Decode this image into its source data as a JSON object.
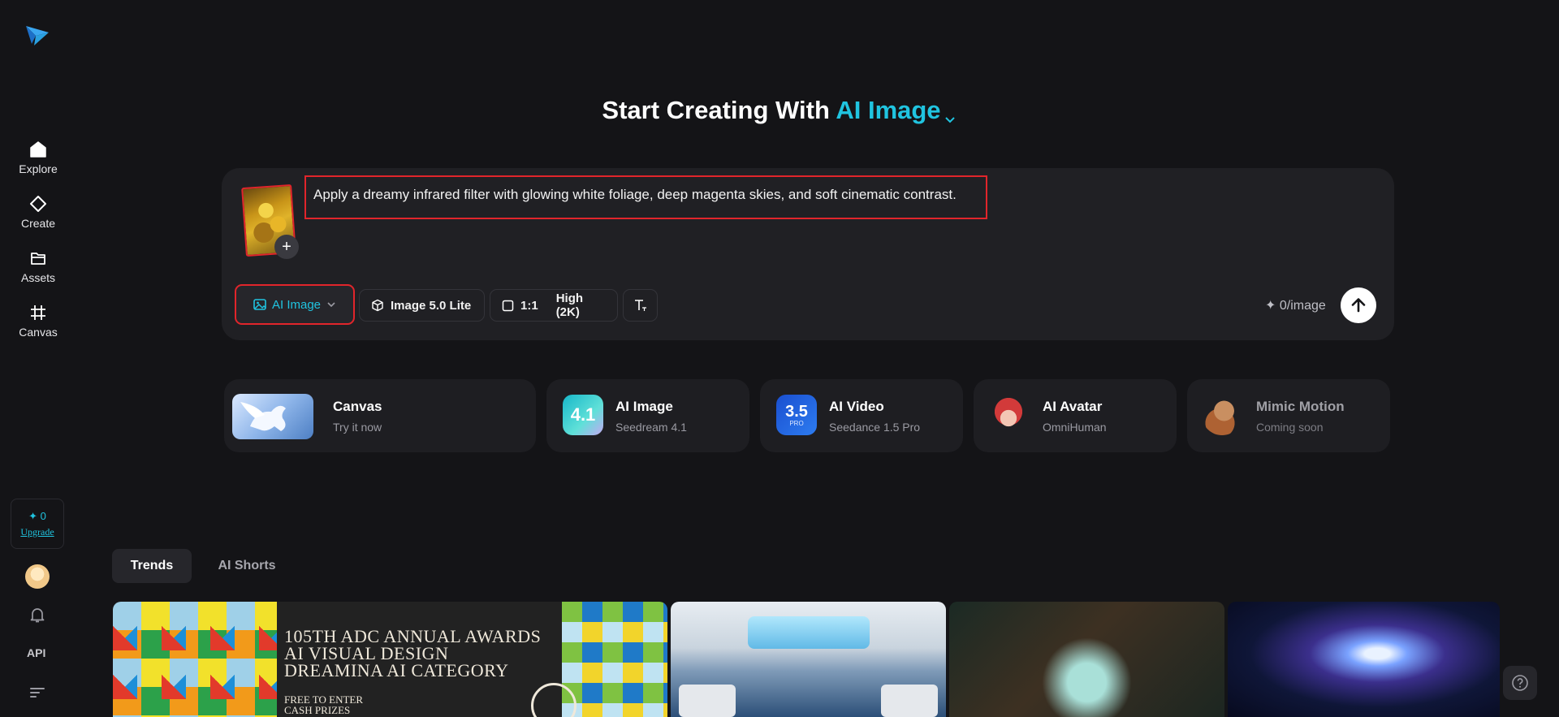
{
  "sidebar": {
    "items": [
      {
        "label": "Explore",
        "icon": "home-icon"
      },
      {
        "label": "Create",
        "icon": "diamond-icon"
      },
      {
        "label": "Assets",
        "icon": "folder-icon"
      },
      {
        "label": "Canvas",
        "icon": "frame-icon"
      }
    ],
    "credits": "✦ 0",
    "upgrade": "Upgrade",
    "api": "API"
  },
  "heading": {
    "prefix": "Start Creating With",
    "accent": "AI Image"
  },
  "prompt": {
    "text": "Apply a dreamy infrared filter with glowing white foliage, deep magenta skies, and soft cinematic contrast."
  },
  "toolbar": {
    "mode": "AI Image",
    "model": "Image 5.0 Lite",
    "ratio": "1:1",
    "quality": "High (2K)",
    "cost": "✦ 0/image"
  },
  "features": [
    {
      "title": "Canvas",
      "sub": "Try it now"
    },
    {
      "title": "AI Image",
      "sub": "Seedream 4.1",
      "badge": "4.1"
    },
    {
      "title": "AI Video",
      "sub": "Seedance 1.5 Pro",
      "badge": "3.5",
      "badge_sub": "PRO"
    },
    {
      "title": "AI Avatar",
      "sub": "OmniHuman"
    },
    {
      "title": "Mimic Motion",
      "sub": "Coming soon"
    }
  ],
  "tabs": [
    "Trends",
    "AI Shorts"
  ],
  "gallery": {
    "banner_lines": [
      "105TH ADC ANNUAL AWARDS",
      "AI VISUAL DESIGN",
      "DREAMINA AI CATEGORY"
    ],
    "banner_sub_lines": [
      "FREE TO ENTER",
      "CASH PRIZES"
    ]
  },
  "colors": {
    "accent": "#20c4e0",
    "highlight": "#e1252b",
    "background": "#141417"
  }
}
